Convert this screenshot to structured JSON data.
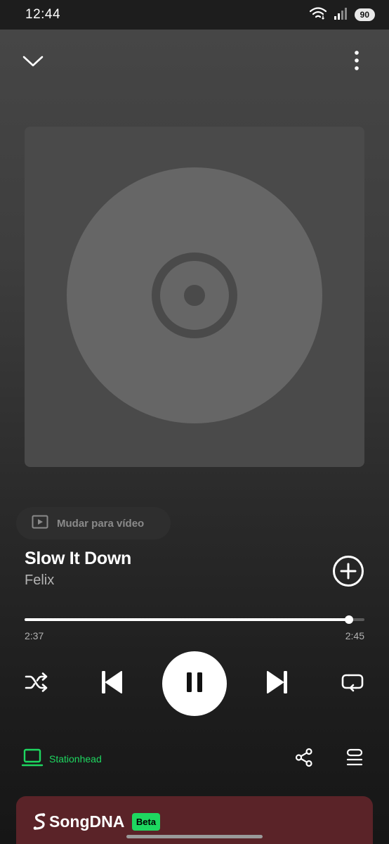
{
  "status_bar": {
    "time": "12:44",
    "battery": "90"
  },
  "header": {
    "collapse_icon": "chevron-down-icon",
    "menu_icon": "more-vertical-icon"
  },
  "artwork": {
    "placeholder_icon": "disc-icon"
  },
  "video_toggle": {
    "label": "Mudar para vídeo",
    "icon": "video-icon"
  },
  "track": {
    "title": "Slow It Down",
    "artist": "Felix"
  },
  "progress": {
    "elapsed": "2:37",
    "total": "2:45",
    "fraction": 0.955
  },
  "controls": {
    "shuffle_icon": "shuffle-icon",
    "previous_icon": "skip-previous-icon",
    "pause_icon": "pause-icon",
    "next_icon": "skip-next-icon",
    "repeat_icon": "repeat-icon"
  },
  "footer": {
    "device_label": "Stationhead",
    "share_icon": "share-icon",
    "queue_icon": "queue-icon"
  },
  "songdna": {
    "title": "SongDNA",
    "badge": "Beta"
  },
  "colors": {
    "accent": "#1ed760",
    "card": "#5a2328"
  }
}
